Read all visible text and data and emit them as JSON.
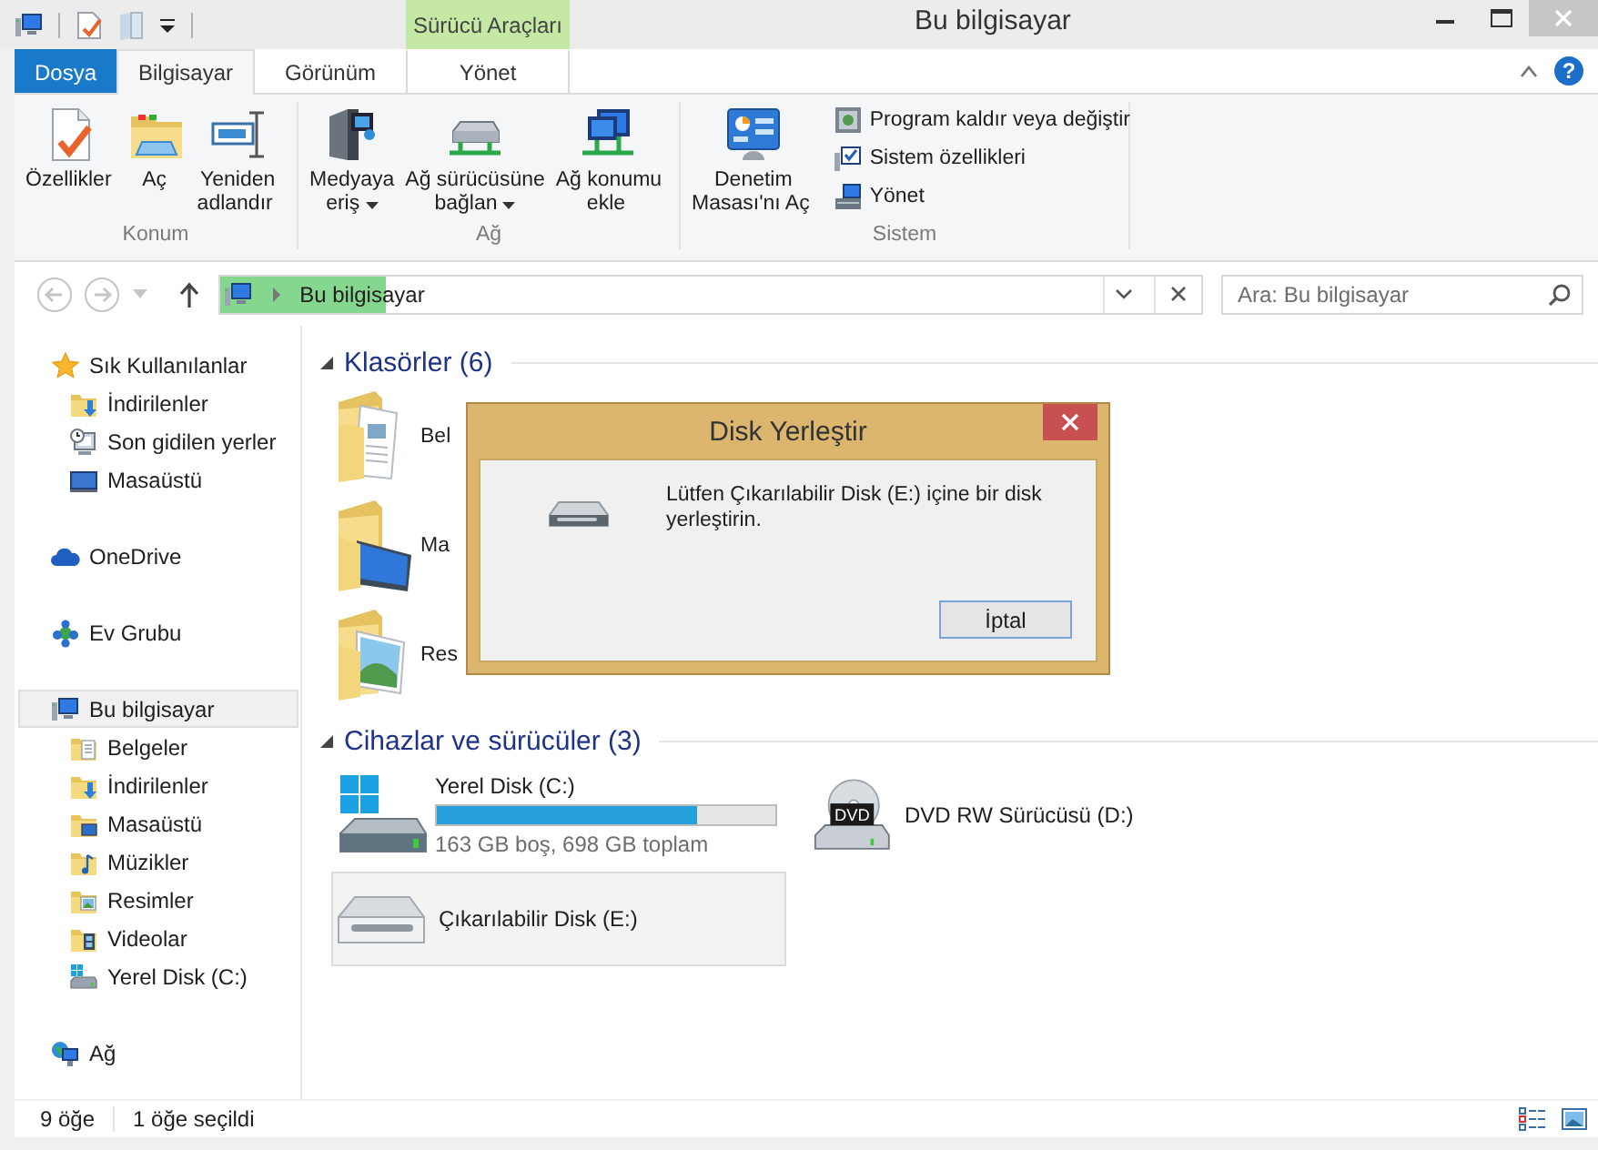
{
  "title_bar": {
    "title": "Bu bilgisayar",
    "context_group": "Sürücü Araçları"
  },
  "ribbon": {
    "tabs": [
      {
        "label": "Dosya",
        "kind": "file",
        "selected": false
      },
      {
        "label": "Bilgisayar",
        "kind": "normal",
        "selected": true
      },
      {
        "label": "Görünüm",
        "kind": "normal",
        "selected": false
      },
      {
        "label": "Yönet",
        "kind": "context",
        "selected": false
      }
    ],
    "groups": [
      {
        "label": "Konum",
        "buttons": [
          {
            "lines": [
              "Özellikler"
            ],
            "kind": "properties",
            "dropdown": false
          },
          {
            "lines": [
              "Aç"
            ],
            "kind": "open",
            "dropdown": false
          },
          {
            "lines": [
              "Yeniden",
              "adlandır"
            ],
            "kind": "rename",
            "dropdown": false
          }
        ]
      },
      {
        "label": "Ağ",
        "buttons": [
          {
            "lines": [
              "Medyaya",
              "eriş"
            ],
            "kind": "media",
            "dropdown": true
          },
          {
            "lines": [
              "Ağ sürücüsüne",
              "bağlan"
            ],
            "kind": "netdrive",
            "dropdown": true
          },
          {
            "lines": [
              "Ağ konumu",
              "ekle"
            ],
            "kind": "netplace",
            "dropdown": false
          }
        ]
      },
      {
        "label": "Sistem",
        "buttons": [
          {
            "lines": [
              "Denetim",
              "Masası'nı Aç"
            ],
            "kind": "control",
            "dropdown": false
          }
        ],
        "small_buttons": [
          {
            "label": "Program kaldır veya değiştir",
            "kind": "programs"
          },
          {
            "label": "Sistem özellikleri",
            "kind": "sysprops"
          },
          {
            "label": "Yönet",
            "kind": "manage"
          }
        ]
      }
    ],
    "help": "?"
  },
  "address_bar": {
    "location": "Bu bilgisayar",
    "level": 0.17
  },
  "search": {
    "placeholder": "Ara: Bu bilgisayar"
  },
  "sidebar": {
    "items": [
      {
        "label": "Sık Kullanılanlar",
        "kind": "star",
        "selected": false,
        "children": [
          {
            "label": "İndirilenler",
            "kind": "downloads",
            "selected": false
          },
          {
            "label": "Son gidilen yerler",
            "kind": "recent",
            "selected": false
          },
          {
            "label": "Masaüstü",
            "kind": "desktop",
            "selected": false
          }
        ]
      },
      {
        "label": "OneDrive",
        "kind": "cloud",
        "selected": false
      },
      {
        "label": "Ev Grubu",
        "kind": "homegroup",
        "selected": false
      },
      {
        "label": "Bu bilgisayar",
        "kind": "computer",
        "selected": true,
        "children": [
          {
            "label": "Belgeler",
            "kind": "documents",
            "selected": false
          },
          {
            "label": "İndirilenler",
            "kind": "downloads",
            "selected": false
          },
          {
            "label": "Masaüstü",
            "kind": "desktopfolder",
            "selected": false
          },
          {
            "label": "Müzikler",
            "kind": "music",
            "selected": false
          },
          {
            "label": "Resimler",
            "kind": "pictures",
            "selected": false
          },
          {
            "label": "Videolar",
            "kind": "videos",
            "selected": false
          },
          {
            "label": "Yerel Disk (C:)",
            "kind": "drive",
            "selected": false
          }
        ]
      },
      {
        "label": "Ağ",
        "kind": "network",
        "selected": false
      }
    ]
  },
  "sections": [
    {
      "title": "Klasörler (6)",
      "kind": "folders",
      "items": [
        {
          "name": "Bel",
          "kind": "documents"
        },
        {
          "name": "Ma",
          "kind": "desktop"
        },
        {
          "name": "Res",
          "kind": "pictures"
        }
      ]
    },
    {
      "title": "Cihazlar ve sürücüler (3)",
      "kind": "drives",
      "items": [
        {
          "name": "Yerel Disk (C:)",
          "kind": "hdd",
          "level": 0.77,
          "info": "163 GB boş, 698 GB toplam",
          "selected": false
        },
        {
          "name": "DVD RW Sürücüsü (D:)",
          "kind": "dvd",
          "badge": "DVD",
          "selected": false
        },
        {
          "name": "Çıkarılabilir Disk (E:)",
          "kind": "removable",
          "selected": true
        }
      ]
    }
  ],
  "status_bar": {
    "items": "9 öğe",
    "selection": "1 öğe seçildi"
  },
  "dialog": {
    "title": "Disk Yerleştir",
    "message": "Lütfen Çıkarılabilir Disk (E:) içine bir disk yerleştirin.",
    "button": "İptal"
  }
}
